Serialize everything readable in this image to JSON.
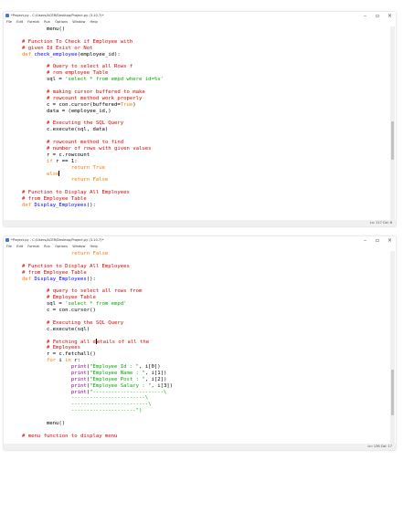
{
  "windows": [
    {
      "title": "*Project.py - C:/Users/ACER/Desktop/Project.py (3.10.7)*",
      "menu": [
        "File",
        "Edit",
        "Format",
        "Run",
        "Options",
        "Window",
        "Help"
      ],
      "controls": {
        "minimize": "–",
        "maximize": "▫",
        "close": "×"
      },
      "status": "Ln: 117   Col: 8",
      "code": [
        [
          {
            "t": "        menu()"
          }
        ],
        [
          {
            "t": ""
          }
        ],
        [
          {
            "t": "# Function To Check if Employee with",
            "c": "comment"
          }
        ],
        [
          {
            "t": "# given Id Exist or Not",
            "c": "comment"
          }
        ],
        [
          {
            "t": "def ",
            "c": "keyword"
          },
          {
            "t": "check_employee",
            "c": "defname"
          },
          {
            "t": "(employee_id):"
          }
        ],
        [
          {
            "t": ""
          }
        ],
        [
          {
            "t": "        "
          },
          {
            "t": "# Query to select all Rows f",
            "c": "comment"
          }
        ],
        [
          {
            "t": "        "
          },
          {
            "t": "# rom employee Table",
            "c": "comment"
          }
        ],
        [
          {
            "t": "        sql = "
          },
          {
            "t": "'select * from empd where id=%s'",
            "c": "string"
          }
        ],
        [
          {
            "t": ""
          }
        ],
        [
          {
            "t": "        "
          },
          {
            "t": "# making cursor buffered to make",
            "c": "comment"
          }
        ],
        [
          {
            "t": "        "
          },
          {
            "t": "# rowcount method work properly",
            "c": "comment"
          }
        ],
        [
          {
            "t": "        c = con.cursor(buffered="
          },
          {
            "t": "True",
            "c": "keyword"
          },
          {
            "t": ")"
          }
        ],
        [
          {
            "t": "        data = (employee_id,)"
          }
        ],
        [
          {
            "t": ""
          }
        ],
        [
          {
            "t": "        "
          },
          {
            "t": "# Executing the SQL Query",
            "c": "comment"
          }
        ],
        [
          {
            "t": "        c.execute(sql, data)"
          }
        ],
        [
          {
            "t": ""
          }
        ],
        [
          {
            "t": "        "
          },
          {
            "t": "# rowcount method to find",
            "c": "comment"
          }
        ],
        [
          {
            "t": "        "
          },
          {
            "t": "# number of rows with given values",
            "c": "comment"
          }
        ],
        [
          {
            "t": "        r = c.rowcount"
          }
        ],
        [
          {
            "t": "        "
          },
          {
            "t": "if",
            "c": "keyword"
          },
          {
            "t": " r == 1:"
          }
        ],
        [
          {
            "t": "                "
          },
          {
            "t": "return True",
            "c": "keyword"
          }
        ],
        [
          {
            "t": "        "
          },
          {
            "t": "else",
            "c": "keyword"
          },
          {
            "caret": true
          }
        ],
        [
          {
            "t": "                "
          },
          {
            "t": "return False",
            "c": "keyword"
          }
        ],
        [
          {
            "t": ""
          }
        ],
        [
          {
            "t": "# Function to Display All Employees",
            "c": "comment"
          }
        ],
        [
          {
            "t": "# from Employee Table",
            "c": "comment"
          }
        ],
        [
          {
            "t": "def ",
            "c": "keyword"
          },
          {
            "t": "Display_Employees",
            "c": "defname"
          },
          {
            "t": "():"
          }
        ]
      ]
    },
    {
      "title": "*Project.py - C:/Users/ACER/Desktop/Project.py (3.10.7)*",
      "menu": [
        "File",
        "Edit",
        "Format",
        "Run",
        "Options",
        "Window",
        "Help"
      ],
      "controls": {
        "minimize": "–",
        "maximize": "▫",
        "close": "×"
      },
      "status": "Ln: 136   Col: 17",
      "code": [
        [
          {
            "t": "                "
          },
          {
            "t": "return False",
            "c": "keyword"
          }
        ],
        [
          {
            "t": ""
          }
        ],
        [
          {
            "t": "# Function to Display All Employees",
            "c": "comment"
          }
        ],
        [
          {
            "t": "# from Employee Table",
            "c": "comment"
          }
        ],
        [
          {
            "t": "def ",
            "c": "keyword"
          },
          {
            "t": "Display_Employees",
            "c": "defname"
          },
          {
            "t": "():"
          }
        ],
        [
          {
            "t": ""
          }
        ],
        [
          {
            "t": "        "
          },
          {
            "t": "# query to select all rows from",
            "c": "comment"
          }
        ],
        [
          {
            "t": "        "
          },
          {
            "t": "# Employee Table",
            "c": "comment"
          }
        ],
        [
          {
            "t": "        sql = "
          },
          {
            "t": "'select * from empd'",
            "c": "string"
          }
        ],
        [
          {
            "t": "        c = con.cursor()"
          }
        ],
        [
          {
            "t": ""
          }
        ],
        [
          {
            "t": "        "
          },
          {
            "t": "# Executing the SQL Query",
            "c": "comment"
          }
        ],
        [
          {
            "t": "        c.execute(sql)"
          }
        ],
        [
          {
            "t": ""
          }
        ],
        [
          {
            "t": "        "
          },
          {
            "t": "# Fetching all d",
            "c": "comment"
          },
          {
            "caret": true
          },
          {
            "t": "etails of all the",
            "c": "comment"
          }
        ],
        [
          {
            "t": "        "
          },
          {
            "t": "# Employees",
            "c": "comment"
          }
        ],
        [
          {
            "t": "        r = c.fetchall()"
          }
        ],
        [
          {
            "t": "        "
          },
          {
            "t": "for",
            "c": "keyword"
          },
          {
            "t": " i "
          },
          {
            "t": "in",
            "c": "keyword"
          },
          {
            "t": " r:"
          }
        ],
        [
          {
            "t": "                "
          },
          {
            "t": "print",
            "c": "builtin"
          },
          {
            "t": "("
          },
          {
            "t": "\"Employee Id : \"",
            "c": "string"
          },
          {
            "t": ", i[0])"
          }
        ],
        [
          {
            "t": "                "
          },
          {
            "t": "print",
            "c": "builtin"
          },
          {
            "t": "("
          },
          {
            "t": "\"Employee Name : \"",
            "c": "string"
          },
          {
            "t": ", i[1])"
          }
        ],
        [
          {
            "t": "                "
          },
          {
            "t": "print",
            "c": "builtin"
          },
          {
            "t": "("
          },
          {
            "t": "\"Employee Post : \"",
            "c": "string"
          },
          {
            "t": ", i[2])"
          }
        ],
        [
          {
            "t": "                "
          },
          {
            "t": "print",
            "c": "builtin"
          },
          {
            "t": "("
          },
          {
            "t": "\"Employee Salary : \"",
            "c": "string"
          },
          {
            "t": ", i[3])"
          }
        ],
        [
          {
            "t": "                "
          },
          {
            "t": "print",
            "c": "builtin"
          },
          {
            "t": "("
          },
          {
            "t": "\"-----------------------\\",
            "c": "string"
          }
        ],
        [
          {
            "t": "                "
          },
          {
            "t": "------------------------\\",
            "c": "string"
          }
        ],
        [
          {
            "t": "                "
          },
          {
            "t": "-------------------------\\",
            "c": "string"
          }
        ],
        [
          {
            "t": "                "
          },
          {
            "t": "---------------------\")",
            "c": "string"
          }
        ],
        [
          {
            "t": ""
          }
        ],
        [
          {
            "t": "        menu()"
          }
        ],
        [
          {
            "t": ""
          }
        ],
        [
          {
            "t": "# menu function to display menu",
            "c": "comment"
          }
        ]
      ]
    }
  ]
}
